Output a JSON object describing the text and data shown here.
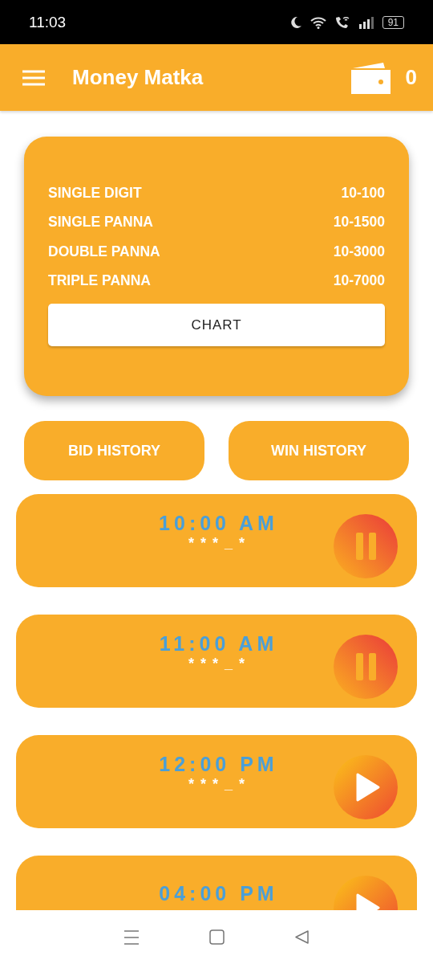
{
  "status_bar": {
    "time": "11:03",
    "battery": "91"
  },
  "app_bar": {
    "title": "Money Matka",
    "wallet_balance": "0"
  },
  "rates_card": {
    "rates": [
      {
        "game": "SINGLE DIGIT",
        "range": "10-100"
      },
      {
        "game": "SINGLE PANNA",
        "range": "10-1500"
      },
      {
        "game": "DOUBLE PANNA",
        "range": "10-3000"
      },
      {
        "game": "TRIPLE PANNA",
        "range": "10-7000"
      }
    ],
    "chart_button": "CHART"
  },
  "history_buttons": [
    "BID HISTORY",
    "WIN HISTORY"
  ],
  "games": [
    {
      "time": "10:00 AM",
      "result": "***_*",
      "kind": "pause"
    },
    {
      "time": "11:00 AM",
      "result": "***_*",
      "kind": "pause"
    },
    {
      "time": "12:00 PM",
      "result": "***_*",
      "kind": "play"
    },
    {
      "time": "04:00 PM",
      "kind": "play"
    }
  ]
}
